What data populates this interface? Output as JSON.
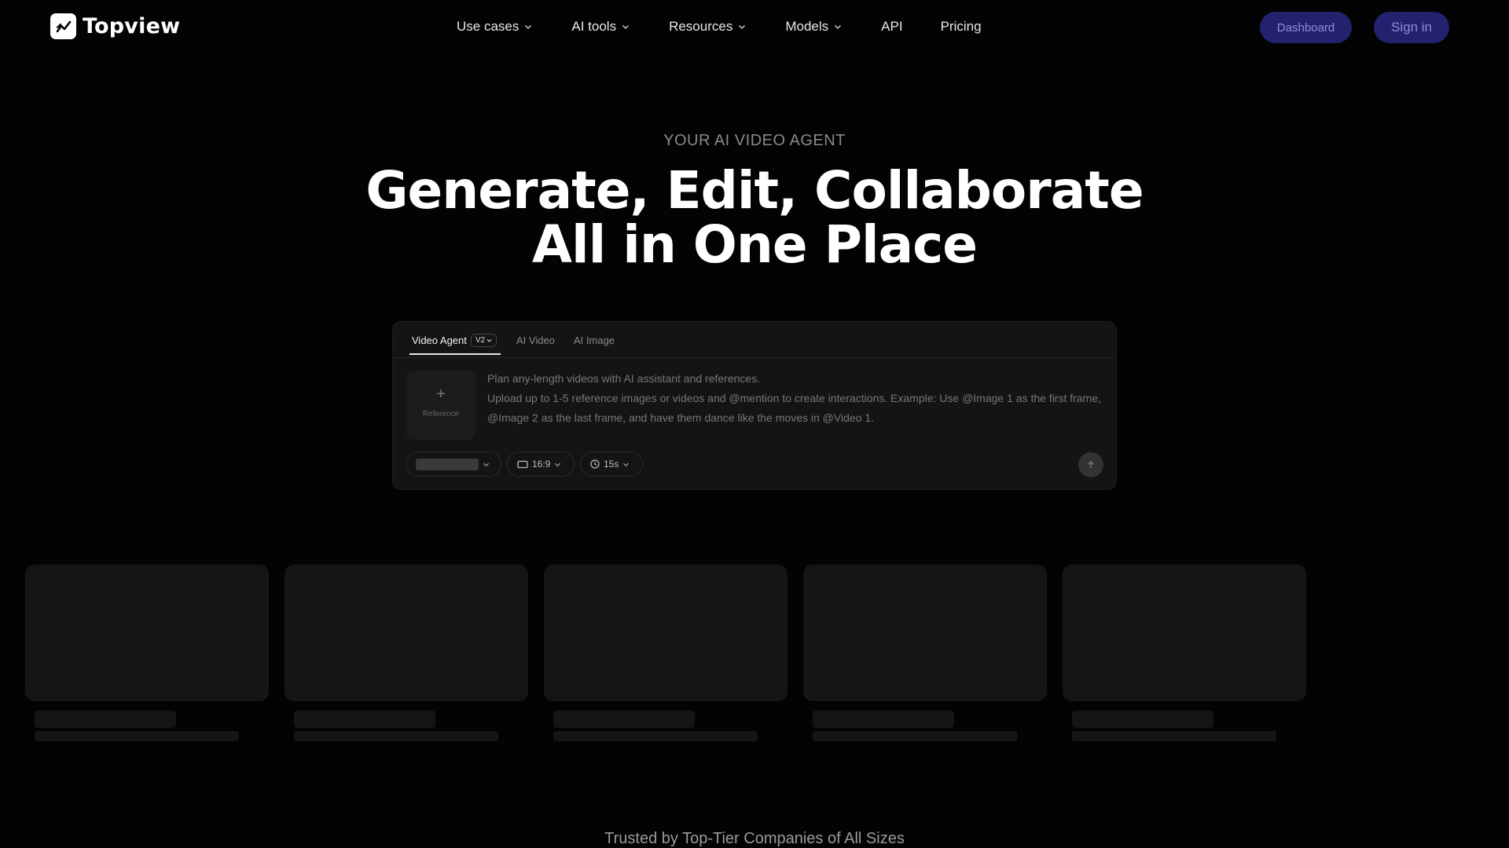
{
  "brand": {
    "name": "Topview"
  },
  "nav": {
    "items": [
      {
        "label": "Use cases",
        "dropdown": true
      },
      {
        "label": "AI tools",
        "dropdown": true
      },
      {
        "label": "Resources",
        "dropdown": true
      },
      {
        "label": "Models",
        "dropdown": true
      },
      {
        "label": "API",
        "dropdown": false
      },
      {
        "label": "Pricing",
        "dropdown": false
      }
    ],
    "dashboard_label": "Dashboard",
    "signin_label": "Sign in"
  },
  "hero": {
    "eyebrow": "YOUR AI VIDEO AGENT",
    "title_line1": "Generate, Edit, Collaborate",
    "title_line2": "All in One Place"
  },
  "composer": {
    "tabs": [
      {
        "label": "Video Agent",
        "active": true
      },
      {
        "label": "AI Video",
        "active": false
      },
      {
        "label": "AI Image",
        "active": false
      }
    ],
    "version_badge": "V2",
    "reference_label": "Reference",
    "prompt_line1": "Plan any-length videos with AI assistant and references.",
    "prompt_line2": "Upload up to 1-5 reference images or videos and @mention to create interactions. Example: Use @Image 1 as the first frame, @Image 2 as the last frame, and have them dance like the moves in @Video 1.",
    "aspect_ratio": "16:9",
    "duration": "15s"
  },
  "footer": {
    "trusted_text": "Trusted by Top-Tier Companies of All Sizes"
  },
  "colors": {
    "background": "#030303",
    "accent_button": "#22226e",
    "accent_text": "#8f8fd6"
  },
  "icons": [
    "topview-logo-icon",
    "chevron-down-icon",
    "plus-icon",
    "aspect-ratio-icon",
    "clock-icon",
    "arrow-up-icon"
  ]
}
